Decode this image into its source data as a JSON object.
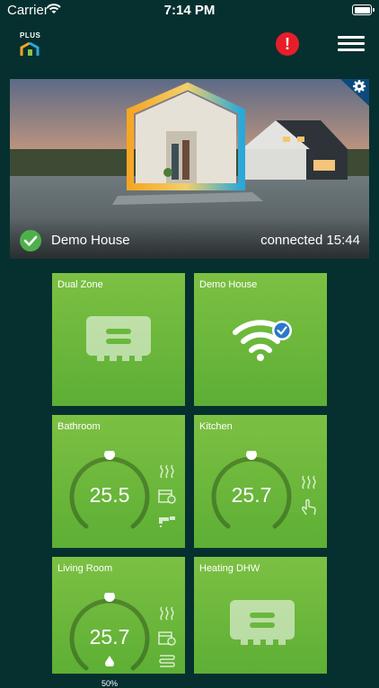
{
  "status_bar": {
    "carrier": "Carrier",
    "time": "7:14 PM",
    "battery_level": 1.0
  },
  "header": {
    "logo_text": "PLUS",
    "alert_glyph": "!",
    "alert_color": "#e61e2a",
    "menu_icon": "hamburger-menu-icon"
  },
  "hero": {
    "home_name": "Demo House",
    "status": "connected 15:44",
    "status_color": "#4fb04b",
    "settings_icon": "gear-icon"
  },
  "tiles": [
    {
      "title": "Dual Zone",
      "type": "controller",
      "icon": "controller-icon"
    },
    {
      "title": "Demo House",
      "type": "wifi",
      "icon": "wifi-connected-icon"
    },
    {
      "title": "Bathroom",
      "type": "thermostat",
      "temp": "25.5",
      "setpoint_fraction": 0.5,
      "icons": [
        "heating-waves-icon",
        "calendar-clock-icon",
        "tap-icon"
      ]
    },
    {
      "title": "Kitchen",
      "type": "thermostat",
      "temp": "25.7",
      "setpoint_fraction": 0.5,
      "icons": [
        "heating-waves-icon",
        "hand-touch-icon"
      ]
    },
    {
      "title": "Living Room",
      "type": "thermostat",
      "temp": "25.7",
      "humidity": "50%",
      "setpoint_fraction": 0.5,
      "icons": [
        "heating-waves-icon",
        "calendar-clock-icon",
        "floor-heating-icon"
      ]
    },
    {
      "title": "Heating DHW",
      "type": "controller",
      "icon": "controller-icon"
    }
  ],
  "colors": {
    "background": "#06302f",
    "tile_green": "#6ab83c"
  }
}
